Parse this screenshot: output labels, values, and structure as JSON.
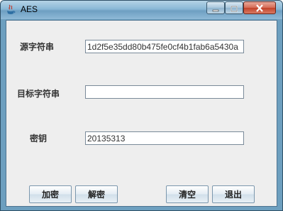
{
  "window": {
    "title": "AES"
  },
  "form": {
    "source_label": "源字符串",
    "source_value": "1d2f5e35dd80b475fe0cf4b1fab6a5430a",
    "target_label": "目标字符串",
    "target_value": "",
    "key_label": "密钥",
    "key_value": "20135313"
  },
  "buttons": {
    "encrypt": "加密",
    "decrypt": "解密",
    "clear": "清空",
    "exit": "退出"
  },
  "colors": {
    "content_bg": "#eeeeee",
    "title_gradient_top": "#b5d3e6",
    "close_red": "#c2422a"
  }
}
